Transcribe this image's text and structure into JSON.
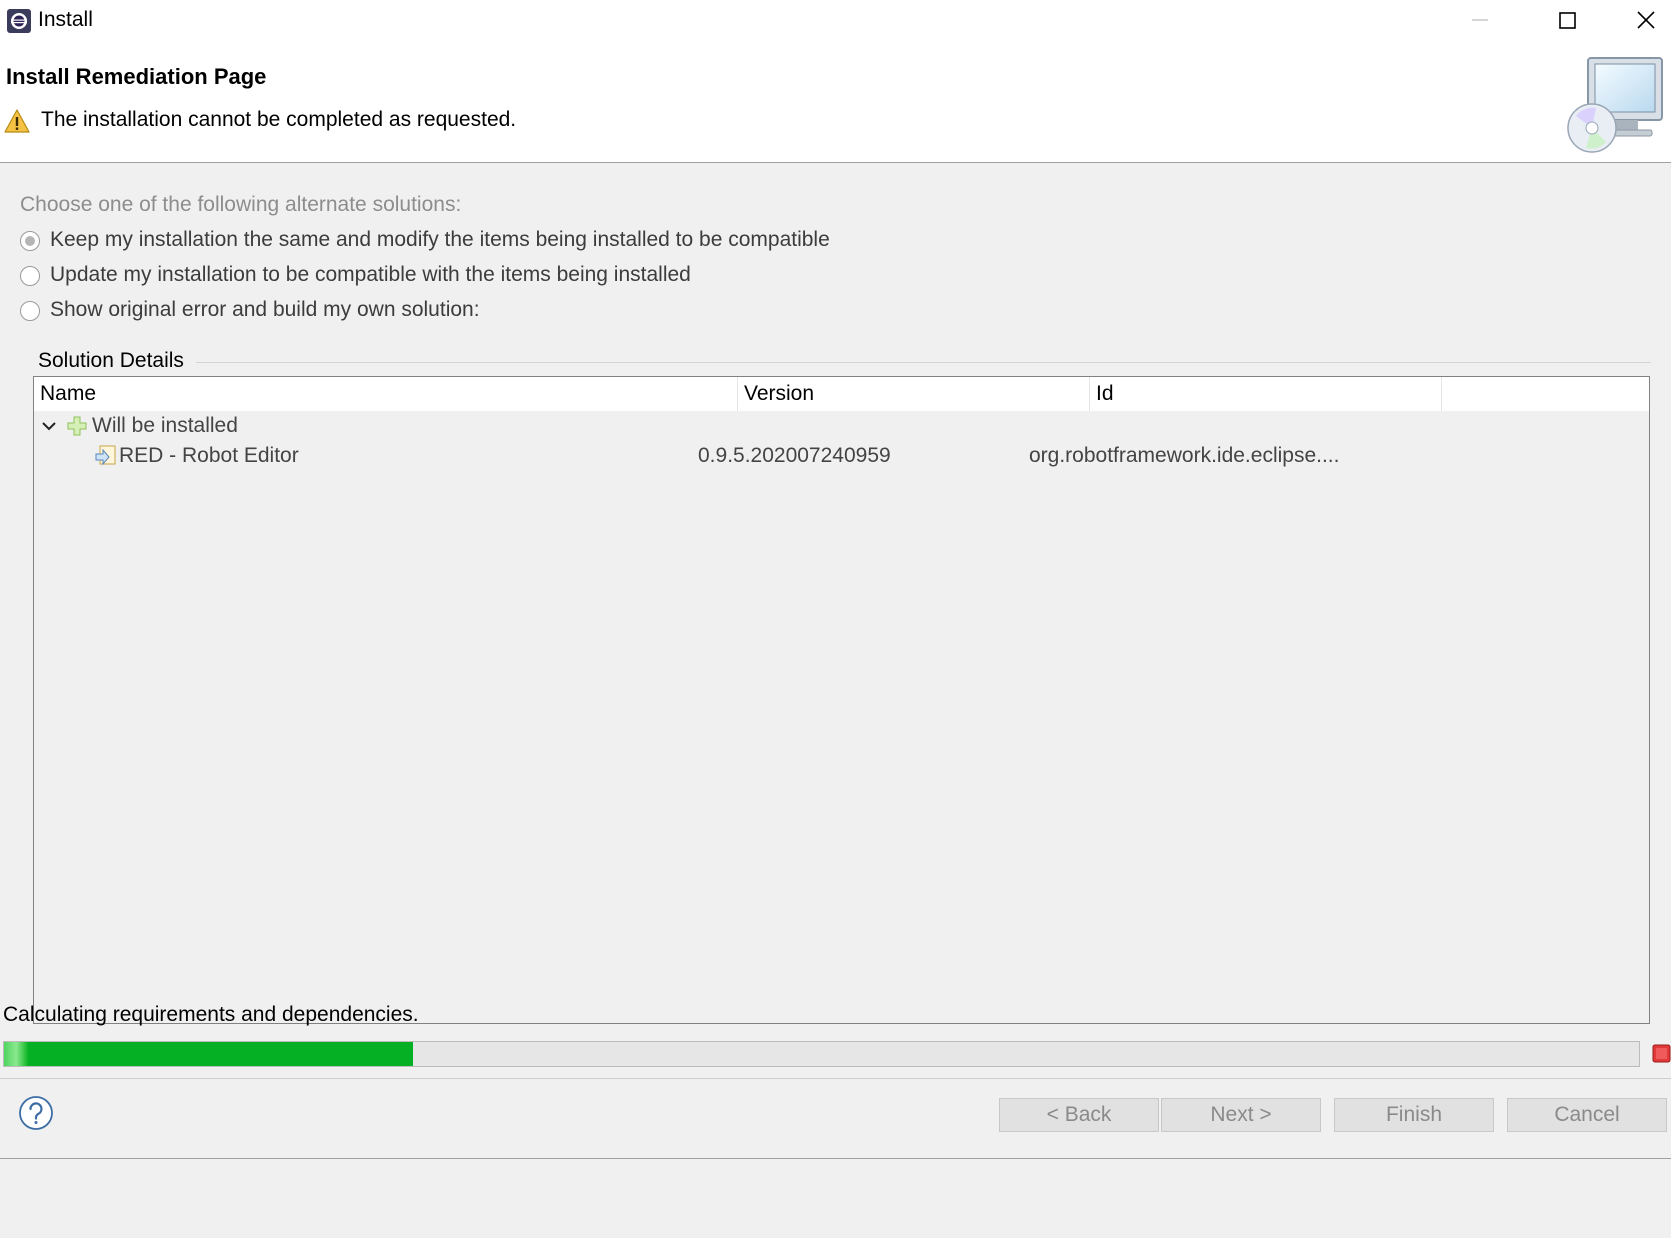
{
  "window": {
    "title": "Install",
    "icons": {
      "app": "eclipse-icon",
      "minimize": "minimize-icon",
      "maximize": "maximize-icon",
      "close": "close-icon"
    }
  },
  "header": {
    "title": "Install Remediation Page",
    "message": "The installation cannot be completed as requested.",
    "message_icon": "warning-icon",
    "banner_icon": "install-wizard-banner-icon"
  },
  "options": {
    "prompt": "Choose one of the following alternate solutions:",
    "items": [
      {
        "label": "Keep my installation the same and modify the items being installed to be compatible",
        "selected": true
      },
      {
        "label": "Update my installation to be compatible with the items being installed",
        "selected": false
      },
      {
        "label": "Show original error and build my own solution:",
        "selected": false
      }
    ]
  },
  "details": {
    "title": "Solution Details",
    "columns": [
      "Name",
      "Version",
      "Id"
    ],
    "group": {
      "label": "Will be installed",
      "expanded": true,
      "icon": "add-icon"
    },
    "items": [
      {
        "name": "RED - Robot Editor",
        "version": "0.9.5.202007240959",
        "id": "org.robotframework.ide.eclipse....",
        "icon": "feature-icon"
      }
    ]
  },
  "status": {
    "text": "Calculating requirements and dependencies.",
    "progress_percent": 25,
    "progress_color": "#06b025",
    "stop_icon": "stop-icon"
  },
  "buttons": {
    "back": "< Back",
    "next": "Next >",
    "finish": "Finish",
    "cancel": "Cancel",
    "help_icon": "help-icon"
  }
}
